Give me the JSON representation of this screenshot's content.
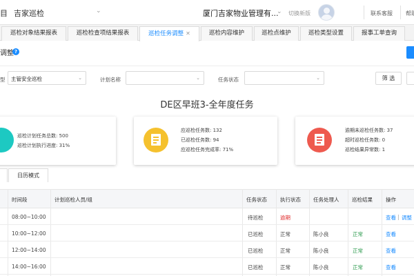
{
  "topbar": {
    "prefix": "目",
    "system_name": "吉家巡检",
    "company": "厦门吉家物业管理有...",
    "switch_label": "切换新版",
    "service": "联系客服",
    "help": "帮助"
  },
  "tabs": [
    {
      "label": "巡检对象结果报表"
    },
    {
      "label": "巡检检查项结果报表"
    },
    {
      "label": "巡检任务调整",
      "active": true
    },
    {
      "label": "巡检内容维护"
    },
    {
      "label": "巡检点维护"
    },
    {
      "label": "巡检类型设置"
    },
    {
      "label": "报事工单查询"
    }
  ],
  "page": {
    "title": "调整",
    "help_icon": "?"
  },
  "filters": {
    "type_label": "型",
    "type_value": "主管安全巡检",
    "plan_label": "计划名称",
    "plan_value": "",
    "status_label": "任务状态",
    "status_value": "",
    "filter_button": "筛 选"
  },
  "task_title": "DE区早班3-全年度任务",
  "cards": [
    {
      "icon": "progress-icon",
      "color": "#1dc9c2",
      "lines": [
        "巡检计划任务总数: 500",
        "巡检计划执行进度: 31%"
      ]
    },
    {
      "icon": "document-icon",
      "color": "#f5c12e",
      "lines": [
        "应巡检任务数: 132",
        "已巡检任务数: 94",
        "应巡检任务完成率: 71%"
      ]
    },
    {
      "icon": "report-icon",
      "color": "#ee5a4f",
      "lines": [
        "逾期未巡检任务数: 37",
        "超时巡检任务数: 0",
        "巡检结果异常数: 1"
      ]
    }
  ],
  "view_tabs": {
    "calendar": "日历模式"
  },
  "table": {
    "headers": {
      "time": "时间段",
      "person": "计划巡检人员/组",
      "task_status": "任务状态",
      "exec_status": "执行状态",
      "handler": "任务处理人",
      "result": "巡检结果",
      "action": "操作"
    },
    "rows": [
      {
        "time": "08:00~10:00",
        "person": "",
        "task_status": "待巡检",
        "exec_status": "逾期",
        "handler": "",
        "result": "",
        "view": "查看",
        "adjust": "调整"
      },
      {
        "time": "10:00~12:00",
        "person": "",
        "task_status": "已巡检",
        "exec_status": "正常",
        "handler": "陈小良",
        "result": "正常",
        "view": "查看",
        "adjust": ""
      },
      {
        "time": "12:00~14:00",
        "person": "",
        "task_status": "已巡检",
        "exec_status": "正常",
        "handler": "陈小良",
        "result": "正常",
        "view": "查看",
        "adjust": ""
      },
      {
        "time": "14:00~16:00",
        "person": "",
        "task_status": "已巡检",
        "exec_status": "正常",
        "handler": "陈小良",
        "result": "正常",
        "view": "查看",
        "adjust": ""
      }
    ]
  }
}
